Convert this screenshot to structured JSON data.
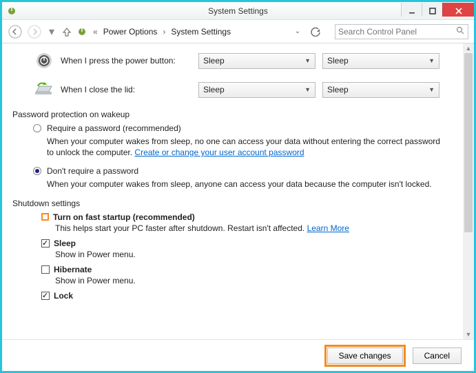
{
  "window": {
    "title": "System Settings"
  },
  "breadcrumb": {
    "a": "Power Options",
    "b": "System Settings"
  },
  "search": {
    "placeholder": "Search Control Panel"
  },
  "power_button": {
    "label": "When I press the power button:",
    "battery": "Sleep",
    "plugged": "Sleep"
  },
  "close_lid": {
    "label": "When I close the lid:",
    "battery": "Sleep",
    "plugged": "Sleep"
  },
  "password_protection": {
    "heading": "Password protection on wakeup",
    "require": {
      "label": "Require a password (recommended)",
      "desc_a": "When your computer wakes from sleep, no one can access your data without entering the correct password to unlock the computer. ",
      "link": "Create or change your user account password"
    },
    "dont_require": {
      "label": "Don't require a password",
      "desc": "When your computer wakes from sleep, anyone can access your data because the computer isn't locked."
    }
  },
  "shutdown": {
    "heading": "Shutdown settings",
    "fast_startup": {
      "label": "Turn on fast startup (recommended)",
      "desc": "This helps start your PC faster after shutdown. Restart isn't affected. ",
      "link": "Learn More"
    },
    "sleep": {
      "label": "Sleep",
      "desc": "Show in Power menu."
    },
    "hibernate": {
      "label": "Hibernate",
      "desc": "Show in Power menu."
    },
    "lock": {
      "label": "Lock"
    }
  },
  "footer": {
    "save": "Save changes",
    "cancel": "Cancel"
  }
}
